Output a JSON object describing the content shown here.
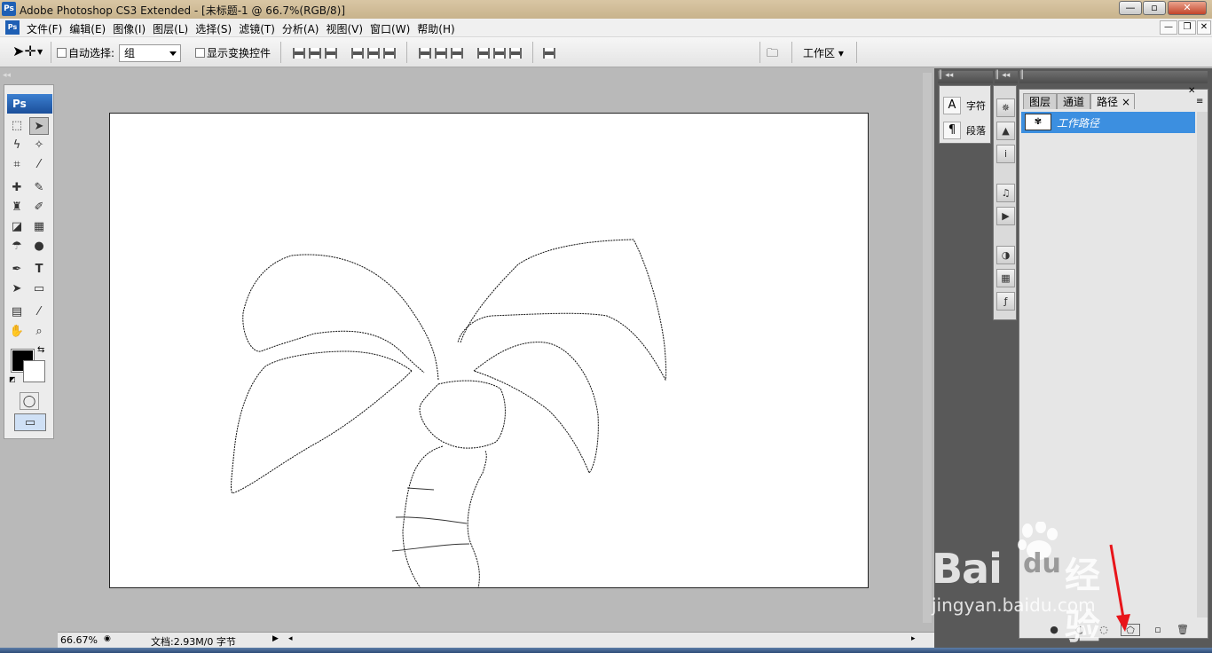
{
  "window": {
    "title": "Adobe Photoshop CS3 Extended - [未标题-1 @ 66.7%(RGB/8)]",
    "app_icon": "Ps",
    "buttons": {
      "minimize": "—",
      "maximize": "▫",
      "close": "✕"
    }
  },
  "menu": {
    "items": [
      "文件(F)",
      "编辑(E)",
      "图像(I)",
      "图层(L)",
      "选择(S)",
      "滤镜(T)",
      "分析(A)",
      "视图(V)",
      "窗口(W)",
      "帮助(H)"
    ],
    "doc_buttons": {
      "minimize": "—",
      "restore": "❐",
      "close": "✕"
    }
  },
  "options": {
    "auto_select_label": "自动选择:",
    "auto_select_value": "组",
    "show_transform_label": "显示变换控件",
    "workspace_label": "工作区 ▾"
  },
  "toolbox": {
    "logo": "Ps"
  },
  "status": {
    "zoom": "66.67%",
    "doc_info": "文档:2.93M/0 字节"
  },
  "char_panel": {
    "char_label": "字符",
    "para_label": "段落",
    "char_icon": "A",
    "para_icon": "¶"
  },
  "paths_panel": {
    "tabs": [
      "图层",
      "通道",
      "路径"
    ],
    "active_tab_close": "×",
    "path_name": "工作路径"
  },
  "watermark": {
    "brand": "Bai",
    "brand_tail": "du",
    "cn": "经验",
    "url": "jingyan.baidu.com"
  },
  "colors": {
    "accent": "#3c8fe0",
    "annotation_arrow": "#e8151a"
  }
}
